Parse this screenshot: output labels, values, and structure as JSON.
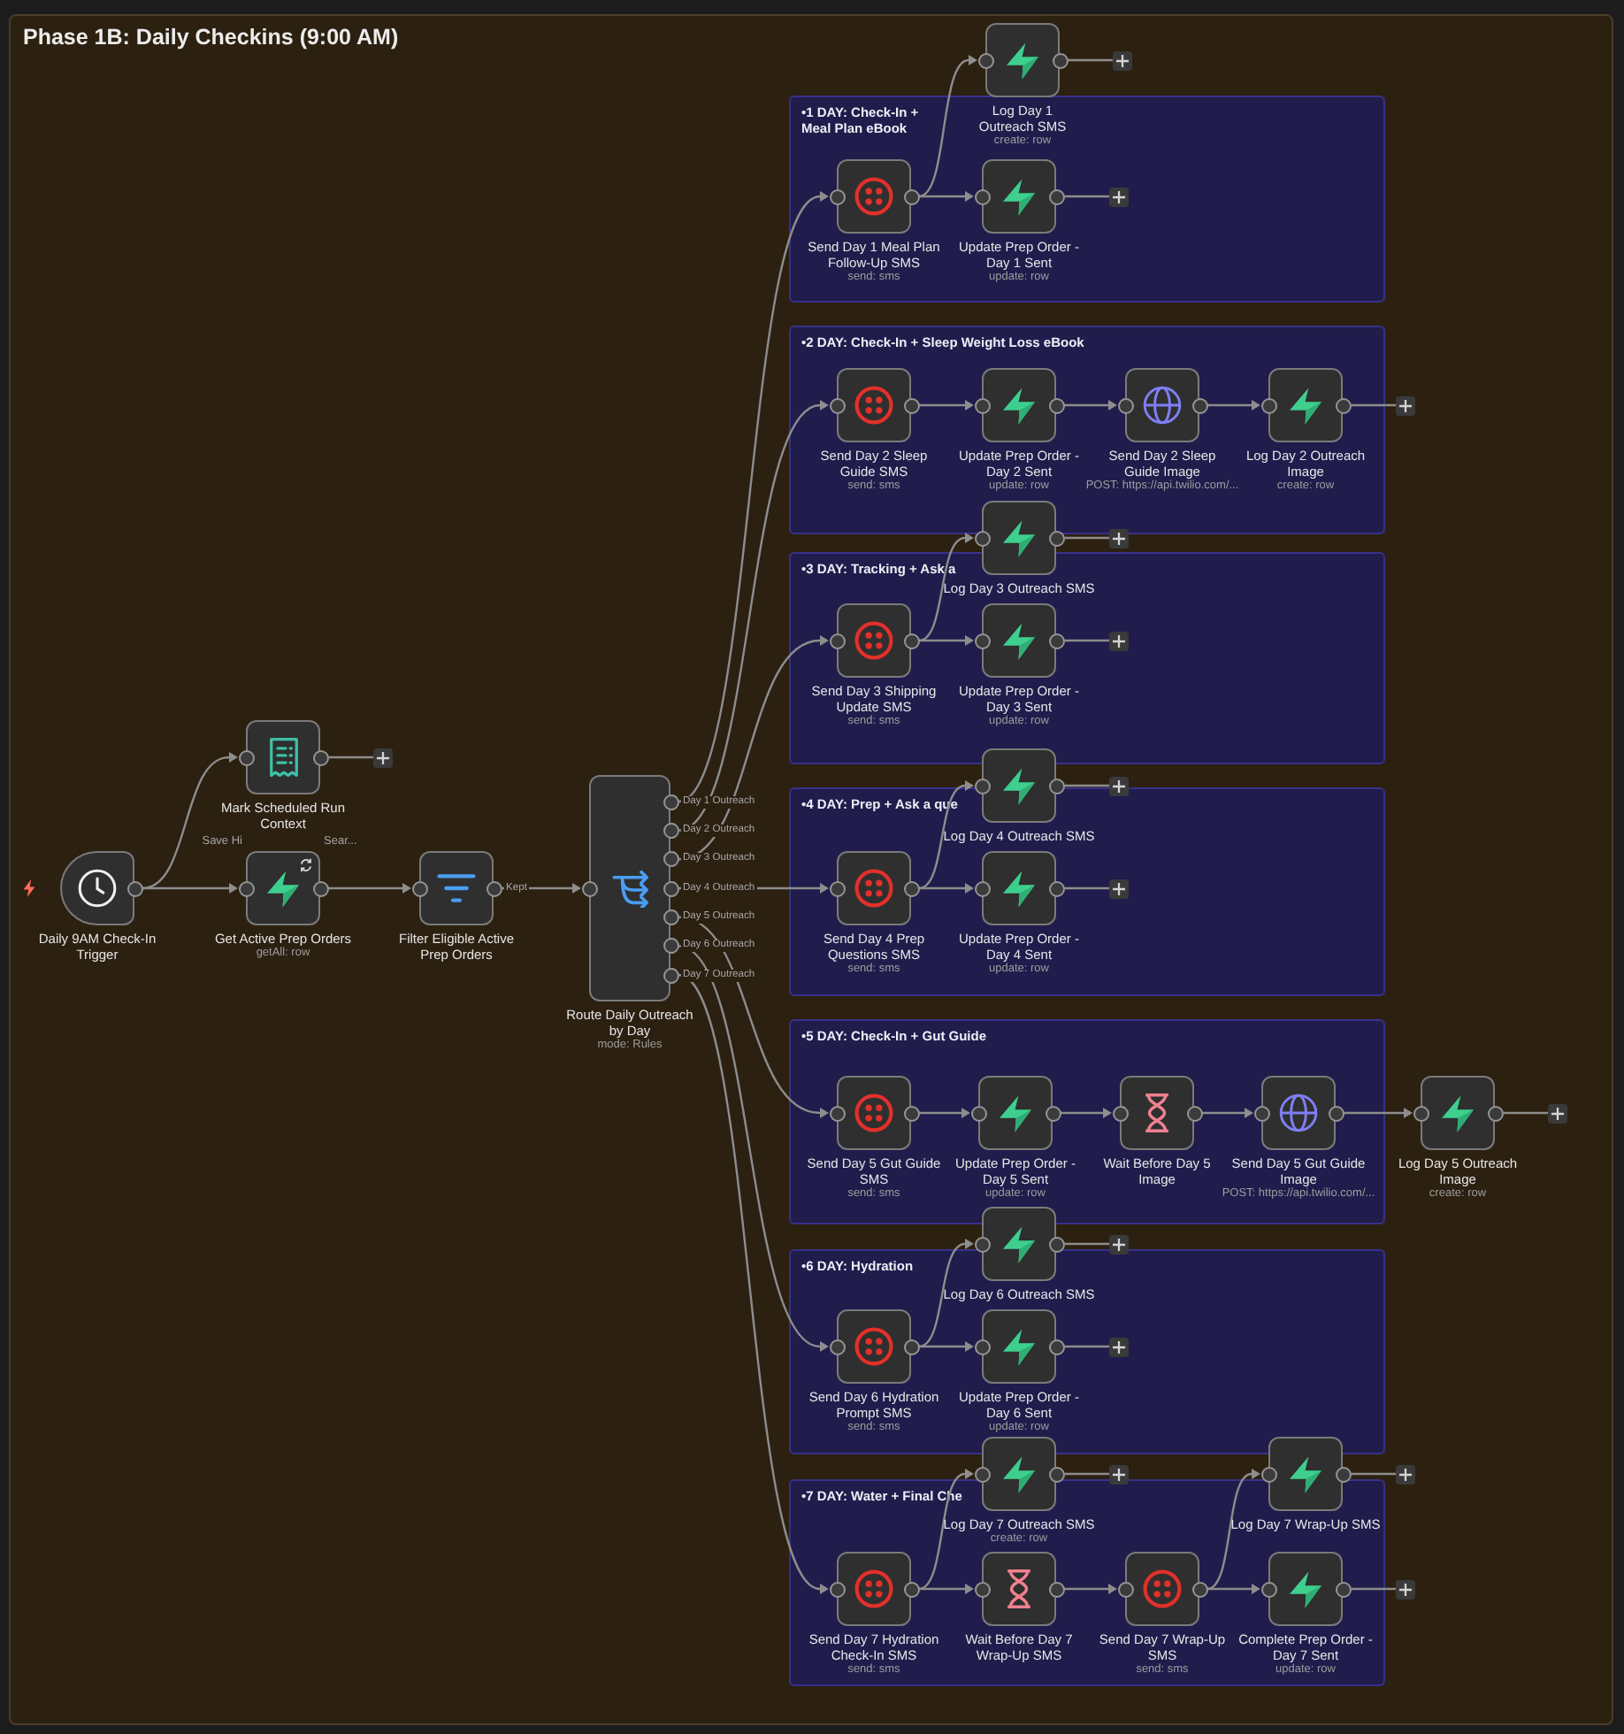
{
  "frame": {
    "title": "Phase 1B: Daily Checkins (9:00 AM)"
  },
  "sticky_notes": [
    {
      "title": "•1 DAY: Check-In + Meal Plan eBook"
    },
    {
      "title": "•2 DAY: Check-In + Sleep Weight Loss eBook"
    },
    {
      "title": "•3 DAY: Tracking + Ask a"
    },
    {
      "title": "•4 DAY: Prep + Ask a que"
    },
    {
      "title": "•5 DAY: Check-In + Gut Guide"
    },
    {
      "title": "•6 DAY: Hydration"
    },
    {
      "title": "•7 DAY: Water + Final Che"
    }
  ],
  "workflow": {
    "kind": "schedule_trigger",
    "name": "Daily 9AM Check-In Trigger",
    "outputs": [
      {
        "next": [
          {
            "kind": "execution_data",
            "name": "Mark Scheduled Run Context",
            "outputs": [
              {
                "add_button": true
              }
            ]
          },
          {
            "kind": "database",
            "name": "Get Active Prep Orders",
            "subtitle": "getAll: row",
            "repeat_badge": true,
            "behind_text": [
              "Save Hi",
              "Sear..."
            ],
            "outputs": [
              {
                "next": [
                  {
                    "kind": "filter",
                    "name": "Filter Eligible Active Prep Orders",
                    "outputs": [
                      {
                        "label": "Kept",
                        "next": [
                          {
                            "kind": "switch",
                            "name": "Route Daily Outreach by Day",
                            "subtitle": "mode: Rules",
                            "outputs": [
                              {
                                "label": "Day 1 Outreach",
                                "next": [
                                  {
                                    "kind": "sms",
                                    "name": "Send Day 1 Meal Plan Follow-Up SMS",
                                    "subtitle": "send: sms",
                                    "outputs": [
                                      {
                                        "next": [
                                          {
                                            "kind": "database",
                                            "name": "Log Day 1 Outreach SMS",
                                            "subtitle": "create: row",
                                            "outputs": [
                                              {
                                                "add_button": true
                                              }
                                            ]
                                          },
                                          {
                                            "kind": "database",
                                            "name": "Update Prep Order - Day 1 Sent",
                                            "subtitle": "update: row",
                                            "outputs": [
                                              {
                                                "add_button": true
                                              }
                                            ]
                                          }
                                        ]
                                      }
                                    ]
                                  }
                                ]
                              },
                              {
                                "label": "Day 2 Outreach",
                                "next": [
                                  {
                                    "kind": "sms",
                                    "name": "Send Day 2 Sleep Guide SMS",
                                    "subtitle": "send: sms",
                                    "outputs": [
                                      {
                                        "next": [
                                          {
                                            "kind": "database",
                                            "name": "Update Prep Order - Day 2 Sent",
                                            "subtitle": "update: row",
                                            "outputs": [
                                              {
                                                "next": [
                                                  {
                                                    "kind": "http_request",
                                                    "name": "Send Day 2 Sleep Guide Image",
                                                    "subtitle": "POST: https://api.twilio.com/...",
                                                    "outputs": [
                                                      {
                                                        "next": [
                                                          {
                                                            "kind": "database",
                                                            "name": "Log Day 2 Outreach Image",
                                                            "subtitle": "create: row",
                                                            "outputs": [
                                                              {
                                                                "add_button": true
                                                              }
                                                            ]
                                                          }
                                                        ]
                                                      }
                                                    ]
                                                  }
                                                ]
                                              }
                                            ]
                                          }
                                        ]
                                      }
                                    ]
                                  }
                                ]
                              },
                              {
                                "label": "Day 3 Outreach",
                                "next": [
                                  {
                                    "kind": "sms",
                                    "name": "Send Day 3 Shipping Update SMS",
                                    "subtitle": "send: sms",
                                    "outputs": [
                                      {
                                        "next": [
                                          {
                                            "kind": "database",
                                            "name": "Log Day 3 Outreach SMS",
                                            "outputs": [
                                              {
                                                "add_button": true
                                              }
                                            ]
                                          },
                                          {
                                            "kind": "database",
                                            "name": "Update Prep Order - Day 3 Sent",
                                            "subtitle": "update: row",
                                            "outputs": [
                                              {
                                                "add_button": true
                                              }
                                            ]
                                          }
                                        ]
                                      }
                                    ]
                                  }
                                ]
                              },
                              {
                                "label": "Day 4 Outreach",
                                "next": [
                                  {
                                    "kind": "sms",
                                    "name": "Send Day 4 Prep Questions SMS",
                                    "subtitle": "send: sms",
                                    "outputs": [
                                      {
                                        "next": [
                                          {
                                            "kind": "database",
                                            "name": "Log Day 4 Outreach SMS",
                                            "outputs": [
                                              {
                                                "add_button": true
                                              }
                                            ]
                                          },
                                          {
                                            "kind": "database",
                                            "name": "Update Prep Order - Day 4 Sent",
                                            "subtitle": "update: row",
                                            "outputs": [
                                              {
                                                "add_button": true
                                              }
                                            ]
                                          }
                                        ]
                                      }
                                    ]
                                  }
                                ]
                              },
                              {
                                "label": "Day 5 Outreach",
                                "next": [
                                  {
                                    "kind": "sms",
                                    "name": "Send Day 5 Gut Guide SMS",
                                    "subtitle": "send: sms",
                                    "outputs": [
                                      {
                                        "next": [
                                          {
                                            "kind": "database",
                                            "name": "Update Prep Order - Day 5 Sent",
                                            "subtitle": "update: row",
                                            "outputs": [
                                              {
                                                "next": [
                                                  {
                                                    "kind": "wait",
                                                    "name": "Wait Before Day 5 Image",
                                                    "outputs": [
                                                      {
                                                        "next": [
                                                          {
                                                            "kind": "http_request",
                                                            "name": "Send Day 5 Gut Guide Image",
                                                            "subtitle": "POST: https://api.twilio.com/...",
                                                            "outputs": [
                                                              {
                                                                "next": [
                                                                  {
                                                                    "kind": "database",
                                                                    "name": "Log Day 5 Outreach Image",
                                                                    "subtitle": "create: row",
                                                                    "outputs": [
                                                                      {
                                                                        "add_button": true
                                                                      }
                                                                    ]
                                                                  }
                                                                ]
                                                              }
                                                            ]
                                                          }
                                                        ]
                                                      }
                                                    ]
                                                  }
                                                ]
                                              }
                                            ]
                                          }
                                        ]
                                      }
                                    ]
                                  }
                                ]
                              },
                              {
                                "label": "Day 6 Outreach",
                                "next": [
                                  {
                                    "kind": "sms",
                                    "name": "Send Day 6 Hydration Prompt SMS",
                                    "subtitle": "send: sms",
                                    "outputs": [
                                      {
                                        "next": [
                                          {
                                            "kind": "database",
                                            "name": "Log Day 6 Outreach SMS",
                                            "outputs": [
                                              {
                                                "add_button": true
                                              }
                                            ]
                                          },
                                          {
                                            "kind": "database",
                                            "name": "Update Prep Order - Day 6 Sent",
                                            "subtitle": "update: row",
                                            "outputs": [
                                              {
                                                "add_button": true
                                              }
                                            ]
                                          }
                                        ]
                                      }
                                    ]
                                  }
                                ]
                              },
                              {
                                "label": "Day 7 Outreach",
                                "next": [
                                  {
                                    "kind": "sms",
                                    "name": "Send Day 7 Hydration Check-In SMS",
                                    "subtitle": "send: sms",
                                    "outputs": [
                                      {
                                        "next": [
                                          {
                                            "kind": "database",
                                            "name": "Log Day 7 Outreach SMS",
                                            "subtitle": "create: row",
                                            "outputs": [
                                              {
                                                "add_button": true
                                              }
                                            ]
                                          },
                                          {
                                            "kind": "wait",
                                            "name": "Wait Before Day 7 Wrap-Up SMS",
                                            "outputs": [
                                              {
                                                "next": [
                                                  {
                                                    "kind": "sms",
                                                    "name": "Send Day 7 Wrap-Up SMS",
                                                    "subtitle": "send: sms",
                                                    "outputs": [
                                                      {
                                                        "next": [
                                                          {
                                                            "kind": "database",
                                                            "name": "Log Day 7 Wrap-Up SMS",
                                                            "outputs": [
                                                              {
                                                                "add_button": true
                                                              }
                                                            ]
                                                          },
                                                          {
                                                            "kind": "database",
                                                            "name": "Complete Prep Order - Day 7 Sent",
                                                            "subtitle": "update: row",
                                                            "outputs": [
                                                              {
                                                                "add_button": true
                                                              }
                                                            ]
                                                          }
                                                        ]
                                                      }
                                                    ]
                                                  }
                                                ]
                                              }
                                            ]
                                          }
                                        ]
                                      }
                                    ]
                                  }
                                ]
                              }
                            ]
                          }
                        ]
                      }
                    ]
                  }
                ]
              }
            ]
          }
        ]
      }
    ]
  }
}
